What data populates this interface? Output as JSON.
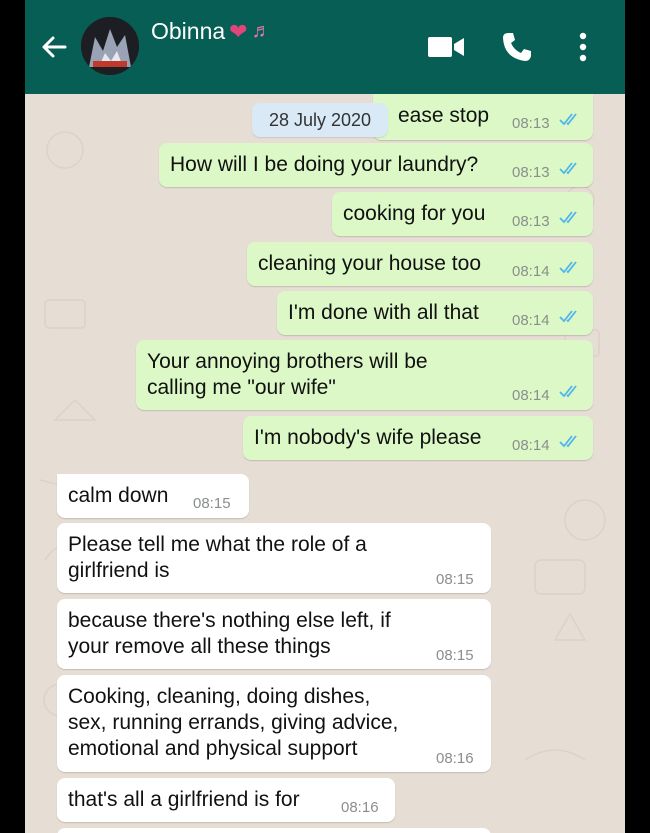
{
  "header": {
    "contact_name": "Obinna",
    "heart_glyph": "❤",
    "notes_glyph": "♬",
    "back_icon": "arrow-left-icon",
    "video_icon": "video-camera-icon",
    "call_icon": "phone-icon",
    "menu_icon": "more-vertical-icon"
  },
  "date_chip": "28 July 2020",
  "messages": [
    {
      "dir": "out",
      "text": "ease stop",
      "time": "08:13",
      "status": "read"
    },
    {
      "dir": "out",
      "text": "How will I be doing your laundry?",
      "time": "08:13",
      "status": "read"
    },
    {
      "dir": "out",
      "text": "cooking for you",
      "time": "08:13",
      "status": "read"
    },
    {
      "dir": "out",
      "text": "cleaning your house too",
      "time": "08:14",
      "status": "read"
    },
    {
      "dir": "out",
      "text": "I'm done with all that",
      "time": "08:14",
      "status": "read"
    },
    {
      "dir": "out",
      "text": "Your annoying brothers will be\ncalling me \"our wife\"",
      "time": "08:14",
      "status": "read"
    },
    {
      "dir": "out",
      "text": "I'm nobody's wife please",
      "time": "08:14",
      "status": "read"
    },
    {
      "dir": "in",
      "text": "calm down",
      "time": "08:15"
    },
    {
      "dir": "in",
      "text": "Please tell me what the role of a\ngirlfriend is",
      "time": "08:15"
    },
    {
      "dir": "in",
      "text": "because there's nothing else left, if\nyour remove all these things",
      "time": "08:15"
    },
    {
      "dir": "in",
      "text": "Cooking, cleaning, doing dishes,\nsex, running errands, giving advice,\nemotional and physical support",
      "time": "08:16"
    },
    {
      "dir": "in",
      "text": "that's all a girlfriend is for",
      "time": "08:16"
    }
  ],
  "colors": {
    "appbar": "#075e54",
    "outgoing_bubble": "#dcf8c6",
    "incoming_bubble": "#ffffff",
    "read_ticks": "#4fb6ec",
    "chat_background": "#e6ddd4"
  }
}
